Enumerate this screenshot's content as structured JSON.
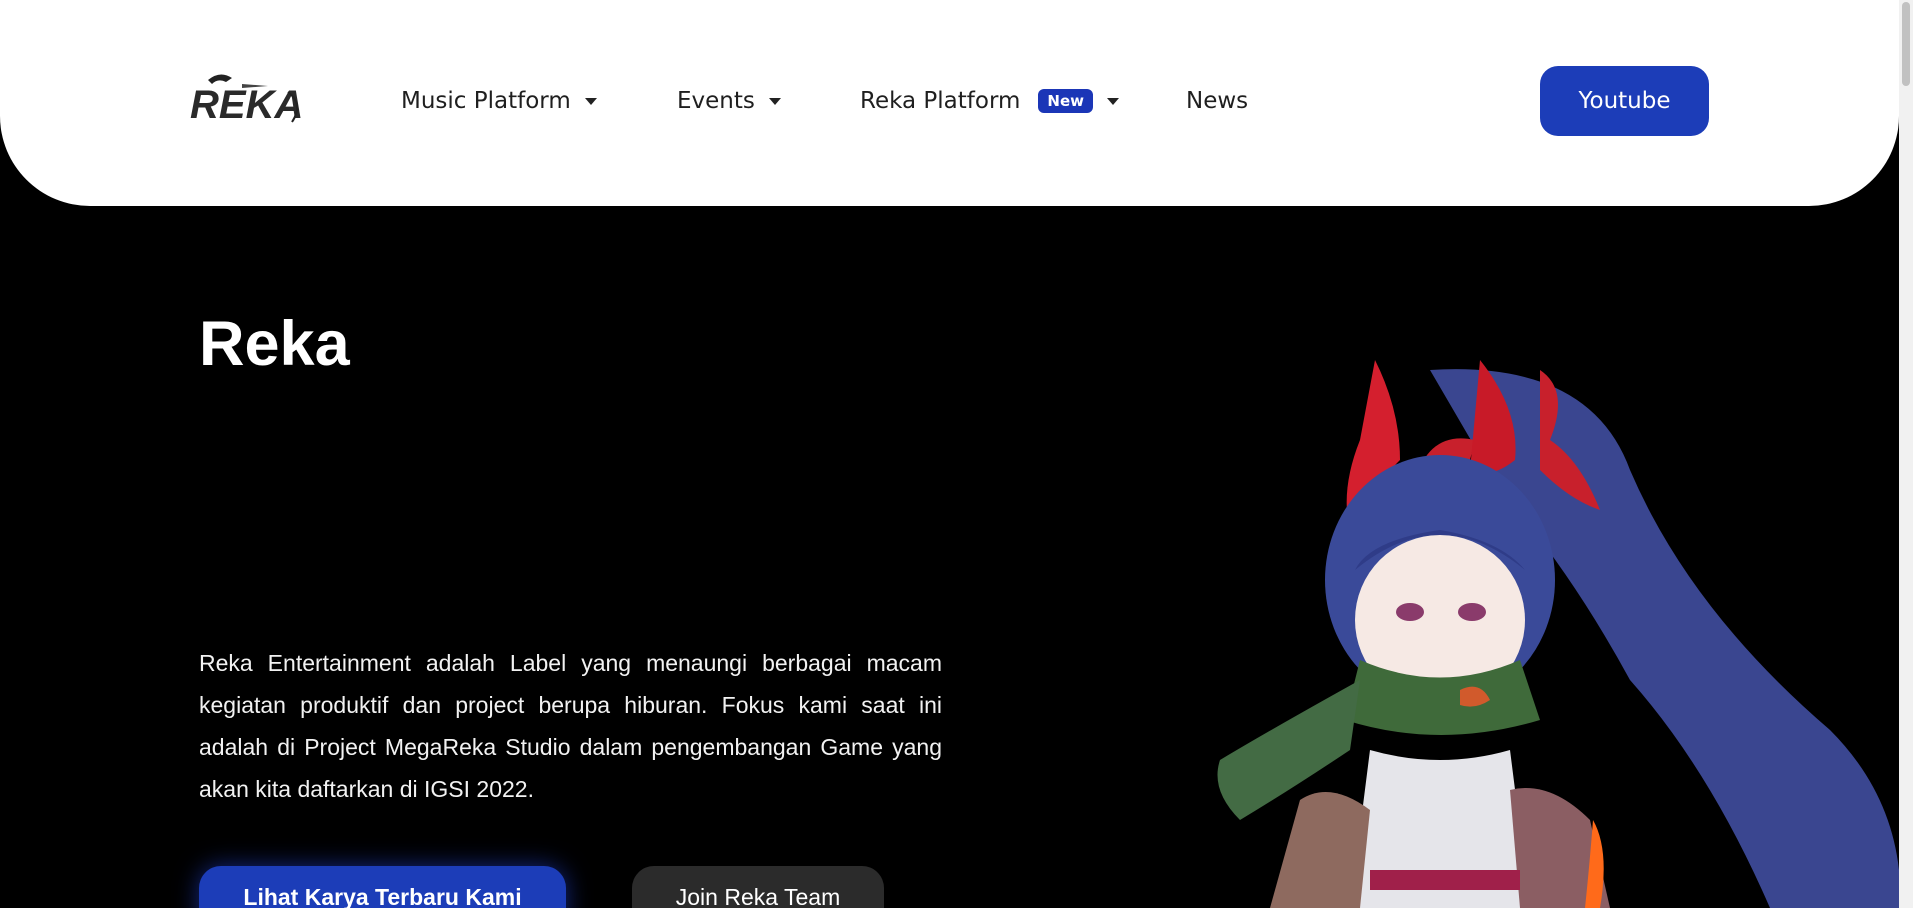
{
  "nav": {
    "logo_text": "REKA",
    "items": [
      {
        "label": "Music Platform",
        "has_dropdown": true
      },
      {
        "label": "Events",
        "has_dropdown": true
      },
      {
        "label": "Reka Platform",
        "badge": "New",
        "has_dropdown": true
      },
      {
        "label": "News",
        "has_dropdown": false
      }
    ],
    "cta": "Youtube"
  },
  "hero": {
    "title": "Reka",
    "description": "Reka Entertainment adalah Label yang menaungi berbagai macam kegiatan produktif dan project berupa hiburan. Fokus kami saat ini adalah di Project MegaReka Studio dalam pengembangan Game yang akan kita daftarkan di IGSI 2022.",
    "primary_button": "Lihat Karya Terbaru Kami",
    "secondary_button": "Join Reka Team"
  },
  "colors": {
    "accent": "#1c3db8",
    "background": "#000000",
    "nav_bg": "#ffffff"
  }
}
